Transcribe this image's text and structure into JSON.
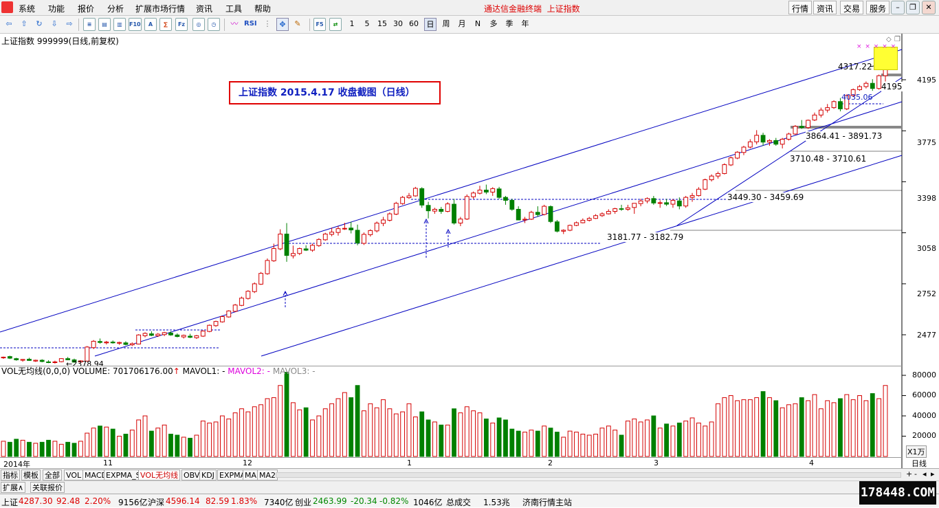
{
  "menubar": {
    "items": [
      "系统",
      "功能",
      "报价",
      "分析",
      "扩展市场行情",
      "资讯",
      "工具",
      "帮助"
    ],
    "app_title": "通达信金融终端",
    "current_index": "上证指数",
    "right_buttons": [
      "行情",
      "资讯",
      "交易",
      "服务"
    ]
  },
  "toolbar": {
    "icons": [
      "back-arrow-icon",
      "up-arrow-icon",
      "refresh-icon",
      "prev-stock-icon",
      "next-stock-icon",
      "list-icon",
      "fund-icon",
      "chart-f10-icon",
      "stock-a-icon",
      "finance-icon",
      "info-icon",
      "circle-icon",
      "rsi-wave-icon"
    ],
    "rsi_label": "RSI",
    "f5_label": "F5",
    "periods": [
      "1",
      "5",
      "15",
      "30",
      "60",
      "日",
      "周",
      "月",
      "N",
      "多",
      "季",
      "年"
    ],
    "active_period": "日"
  },
  "chart": {
    "header": "上证指数 999999(日线,前复权)",
    "annotation": "上证指数  2015.4.17  收盘截图（日线）",
    "price_labels": [
      "4195",
      "3775",
      "3398",
      "3058",
      "2752",
      "2477"
    ],
    "level_labels": [
      "4317.22",
      "4195",
      "4035.06",
      "3864.41 - 3891.73",
      "3710.48 - 3710.61",
      "3449.30 - 3459.69",
      "3181.77 - 3182.79",
      "2378.94"
    ],
    "x_axis_labels": [
      "2014年",
      "11",
      "12",
      "1",
      "2",
      "3",
      "4"
    ],
    "period_label": "日线",
    "volume_header": {
      "name": "VOL无均线(0,0,0)",
      "volume": "VOLUME: 701706176.00",
      "mavol1": "MAVOL1: -",
      "mavol2": "MAVOL2: -",
      "mavol3": "MAVOL3: -"
    },
    "volume_labels": [
      "80000",
      "60000",
      "40000",
      "20000"
    ],
    "volume_unit": "X1万"
  },
  "bottom_tabs": [
    "指标",
    "模板",
    "全部",
    "VOL",
    "MACD",
    "EXPMA_S",
    "VOL无均线",
    "OBV",
    "KDJ",
    "EXPMA",
    "MA",
    "MA2"
  ],
  "active_tab": "VOL无均线",
  "ext_tabs": [
    "扩展∧",
    "关联报价"
  ],
  "statusbar": {
    "sh_label": "上证",
    "sh_price": "4287.30",
    "sh_change": "92.48",
    "sh_pct": "2.20%",
    "sh_amount": "9156亿",
    "hs_label": "沪深",
    "hs_price": "4596.14",
    "hs_change": "82.59",
    "hs_pct": "1.83%",
    "hs_amount": "7340亿",
    "cy_label": "创业",
    "cy_price": "2463.99",
    "cy_change": "-20.34",
    "cy_pct": "-0.82%",
    "cy_amount": "1046亿",
    "total_label": "总成交",
    "total_value": "1.53兆",
    "server": "济南行情主站"
  },
  "watermark": "178448.COM",
  "colors": {
    "up": "#d40000",
    "down": "#008000",
    "channel": "#0000c0",
    "annotation_box": "#e00000"
  },
  "chart_data": {
    "type": "candlestick",
    "title": "上证指数 999999(日线,前复权)",
    "y_ticks": [
      4195,
      3775,
      3398,
      3058,
      2752,
      2477
    ],
    "y_scale": "log",
    "ylim": [
      2330,
      4450
    ],
    "x_ticks": [
      "2014年",
      "11",
      "12",
      "1",
      "2",
      "3",
      "4"
    ],
    "candles": [
      [
        2362,
        2368,
        2357,
        2365,
        15
      ],
      [
        2368,
        2372,
        2356,
        2360,
        14
      ],
      [
        2358,
        2362,
        2348,
        2352,
        17
      ],
      [
        2350,
        2356,
        2343,
        2354,
        16
      ],
      [
        2355,
        2362,
        2347,
        2349,
        14
      ],
      [
        2346,
        2353,
        2342,
        2350,
        13
      ],
      [
        2350,
        2355,
        2340,
        2344,
        14
      ],
      [
        2342,
        2350,
        2336,
        2341,
        16
      ],
      [
        2340,
        2348,
        2334,
        2342,
        15
      ],
      [
        2343,
        2360,
        2340,
        2358,
        12
      ],
      [
        2358,
        2366,
        2350,
        2352,
        14
      ],
      [
        2352,
        2358,
        2338,
        2341,
        13
      ],
      [
        2342,
        2350,
        2336,
        2347,
        15
      ],
      [
        2346,
        2420,
        2344,
        2415,
        23
      ],
      [
        2412,
        2450,
        2405,
        2444,
        28
      ],
      [
        2443,
        2458,
        2432,
        2438,
        30
      ],
      [
        2436,
        2446,
        2428,
        2440,
        29
      ],
      [
        2440,
        2448,
        2432,
        2436,
        27
      ],
      [
        2434,
        2442,
        2426,
        2438,
        20
      ],
      [
        2436,
        2444,
        2424,
        2428,
        22
      ],
      [
        2426,
        2438,
        2420,
        2432,
        26
      ],
      [
        2430,
        2480,
        2428,
        2476,
        36
      ],
      [
        2472,
        2490,
        2464,
        2484,
        40
      ],
      [
        2482,
        2495,
        2470,
        2474,
        25
      ],
      [
        2472,
        2486,
        2466,
        2480,
        28
      ],
      [
        2478,
        2492,
        2470,
        2488,
        31
      ],
      [
        2486,
        2495,
        2472,
        2476,
        22
      ],
      [
        2476,
        2484,
        2464,
        2468,
        21
      ],
      [
        2466,
        2478,
        2458,
        2474,
        19
      ],
      [
        2470,
        2482,
        2460,
        2464,
        18
      ],
      [
        2462,
        2476,
        2456,
        2472,
        21
      ],
      [
        2470,
        2500,
        2466,
        2496,
        35
      ],
      [
        2494,
        2530,
        2490,
        2526,
        33
      ],
      [
        2524,
        2550,
        2518,
        2546,
        34
      ],
      [
        2544,
        2576,
        2540,
        2572,
        40
      ],
      [
        2570,
        2606,
        2566,
        2602,
        37
      ],
      [
        2600,
        2640,
        2596,
        2634,
        43
      ],
      [
        2632,
        2680,
        2628,
        2672,
        47
      ],
      [
        2670,
        2716,
        2664,
        2710,
        44
      ],
      [
        2708,
        2760,
        2700,
        2752,
        49
      ],
      [
        2750,
        2820,
        2746,
        2812,
        51
      ],
      [
        2810,
        2900,
        2804,
        2888,
        57
      ],
      [
        2886,
        2990,
        2880,
        2960,
        58
      ],
      [
        2958,
        3080,
        2950,
        3050,
        70
      ],
      [
        3050,
        3120,
        2880,
        2918,
        83
      ],
      [
        2916,
        2978,
        2900,
        2930,
        53
      ],
      [
        2930,
        2966,
        2920,
        2960,
        46
      ],
      [
        2958,
        2980,
        2945,
        2950,
        48
      ],
      [
        2950,
        2990,
        2940,
        2980,
        36
      ],
      [
        2978,
        3024,
        2970,
        3016,
        40
      ],
      [
        3014,
        3058,
        3008,
        3050,
        47
      ],
      [
        3048,
        3090,
        3036,
        3062,
        52
      ],
      [
        3060,
        3100,
        3040,
        3084,
        57
      ],
      [
        3082,
        3122,
        3076,
        3086,
        63
      ],
      [
        3088,
        3128,
        3054,
        3076,
        58
      ],
      [
        3074,
        3110,
        2980,
        2994,
        70
      ],
      [
        2992,
        3060,
        2982,
        3048,
        45
      ],
      [
        3046,
        3080,
        3034,
        3072,
        52
      ],
      [
        3070,
        3130,
        3060,
        3120,
        48
      ],
      [
        3118,
        3160,
        3100,
        3140,
        56
      ],
      [
        3138,
        3190,
        3130,
        3180,
        47
      ],
      [
        3178,
        3260,
        3172,
        3250,
        42
      ],
      [
        3248,
        3300,
        3240,
        3290,
        44
      ],
      [
        3288,
        3320,
        3280,
        3300,
        52
      ],
      [
        3300,
        3362,
        3295,
        3352,
        39
      ],
      [
        3350,
        3360,
        3220,
        3238,
        44
      ],
      [
        3236,
        3260,
        3150,
        3200,
        36
      ],
      [
        3198,
        3220,
        3180,
        3210,
        34
      ],
      [
        3210,
        3226,
        3180,
        3196,
        31
      ],
      [
        3196,
        3258,
        3190,
        3246,
        31
      ],
      [
        3244,
        3280,
        3110,
        3120,
        47
      ],
      [
        3120,
        3160,
        3100,
        3146,
        43
      ],
      [
        3146,
        3310,
        3140,
        3296,
        49
      ],
      [
        3294,
        3330,
        3280,
        3320,
        45
      ],
      [
        3318,
        3370,
        3310,
        3340,
        43
      ],
      [
        3340,
        3378,
        3312,
        3326,
        37
      ],
      [
        3326,
        3360,
        3300,
        3350,
        33
      ],
      [
        3348,
        3362,
        3280,
        3290,
        38
      ],
      [
        3290,
        3300,
        3240,
        3270,
        36
      ],
      [
        3270,
        3280,
        3200,
        3210,
        27
      ],
      [
        3210,
        3230,
        3170,
        3140,
        25
      ],
      [
        3140,
        3160,
        3120,
        3145,
        24
      ],
      [
        3145,
        3200,
        3140,
        3190,
        26
      ],
      [
        3190,
        3230,
        3160,
        3175,
        25
      ],
      [
        3176,
        3240,
        3170,
        3230,
        30
      ],
      [
        3228,
        3236,
        3120,
        3130,
        28
      ],
      [
        3128,
        3140,
        3060,
        3068,
        24
      ],
      [
        3068,
        3080,
        3050,
        3074,
        19
      ],
      [
        3074,
        3110,
        3068,
        3105,
        25
      ],
      [
        3105,
        3130,
        3100,
        3122,
        24
      ],
      [
        3122,
        3150,
        3118,
        3138,
        22
      ],
      [
        3138,
        3160,
        3130,
        3150,
        21
      ],
      [
        3150,
        3178,
        3146,
        3168,
        22
      ],
      [
        3168,
        3190,
        3160,
        3180,
        28
      ],
      [
        3180,
        3210,
        3176,
        3196,
        30
      ],
      [
        3196,
        3220,
        3180,
        3214,
        26
      ],
      [
        3214,
        3240,
        3200,
        3210,
        21
      ],
      [
        3210,
        3240,
        3200,
        3220,
        35
      ],
      [
        3222,
        3250,
        3180,
        3250,
        37
      ],
      [
        3248,
        3280,
        3230,
        3266,
        34
      ],
      [
        3266,
        3290,
        3250,
        3282,
        36
      ],
      [
        3282,
        3300,
        3240,
        3252,
        40
      ],
      [
        3252,
        3270,
        3220,
        3254,
        28
      ],
      [
        3254,
        3280,
        3232,
        3244,
        32
      ],
      [
        3244,
        3278,
        3220,
        3270,
        30
      ],
      [
        3266,
        3290,
        3210,
        3232,
        33
      ],
      [
        3232,
        3300,
        3220,
        3290,
        35
      ],
      [
        3290,
        3320,
        3260,
        3302,
        38
      ],
      [
        3302,
        3360,
        3296,
        3346,
        33
      ],
      [
        3346,
        3420,
        3340,
        3412,
        30
      ],
      [
        3412,
        3450,
        3400,
        3438,
        34
      ],
      [
        3438,
        3470,
        3420,
        3456,
        52
      ],
      [
        3456,
        3530,
        3450,
        3520,
        58
      ],
      [
        3518,
        3580,
        3510,
        3570,
        60
      ],
      [
        3568,
        3620,
        3560,
        3612,
        55
      ],
      [
        3610,
        3660,
        3590,
        3650,
        56
      ],
      [
        3650,
        3710,
        3640,
        3690,
        56
      ],
      [
        3690,
        3780,
        3670,
        3740,
        58
      ],
      [
        3740,
        3760,
        3660,
        3688,
        64
      ],
      [
        3688,
        3710,
        3660,
        3700,
        58
      ],
      [
        3700,
        3720,
        3660,
        3672,
        55
      ],
      [
        3672,
        3720,
        3640,
        3710,
        48
      ],
      [
        3710,
        3760,
        3700,
        3750,
        51
      ],
      [
        3750,
        3820,
        3744,
        3810,
        52
      ],
      [
        3810,
        3860,
        3790,
        3800,
        58
      ],
      [
        3800,
        3864,
        3790,
        3858,
        55
      ],
      [
        3860,
        3920,
        3852,
        3900,
        61
      ],
      [
        3900,
        3960,
        3880,
        3940,
        47
      ],
      [
        3940,
        3990,
        3920,
        3960,
        55
      ],
      [
        3960,
        4020,
        3950,
        4010,
        53
      ],
      [
        4010,
        4040,
        3930,
        3950,
        57
      ],
      [
        3950,
        4070,
        3940,
        4060,
        61
      ],
      [
        4060,
        4120,
        4050,
        4110,
        56
      ],
      [
        4110,
        4150,
        4100,
        4136,
        60
      ],
      [
        4136,
        4180,
        4120,
        4164,
        55
      ],
      [
        4164,
        4200,
        4100,
        4120,
        62
      ],
      [
        4120,
        4240,
        4110,
        4230,
        57
      ],
      [
        4230,
        4317,
        4180,
        4287,
        70
      ]
    ],
    "channel_levels": [
      "4317.22",
      "4035.06",
      "3864.41 - 3891.73",
      "3710.48 - 3710.61",
      "3449.30 - 3459.69",
      "3181.77 - 3182.79",
      "2378.94"
    ]
  }
}
